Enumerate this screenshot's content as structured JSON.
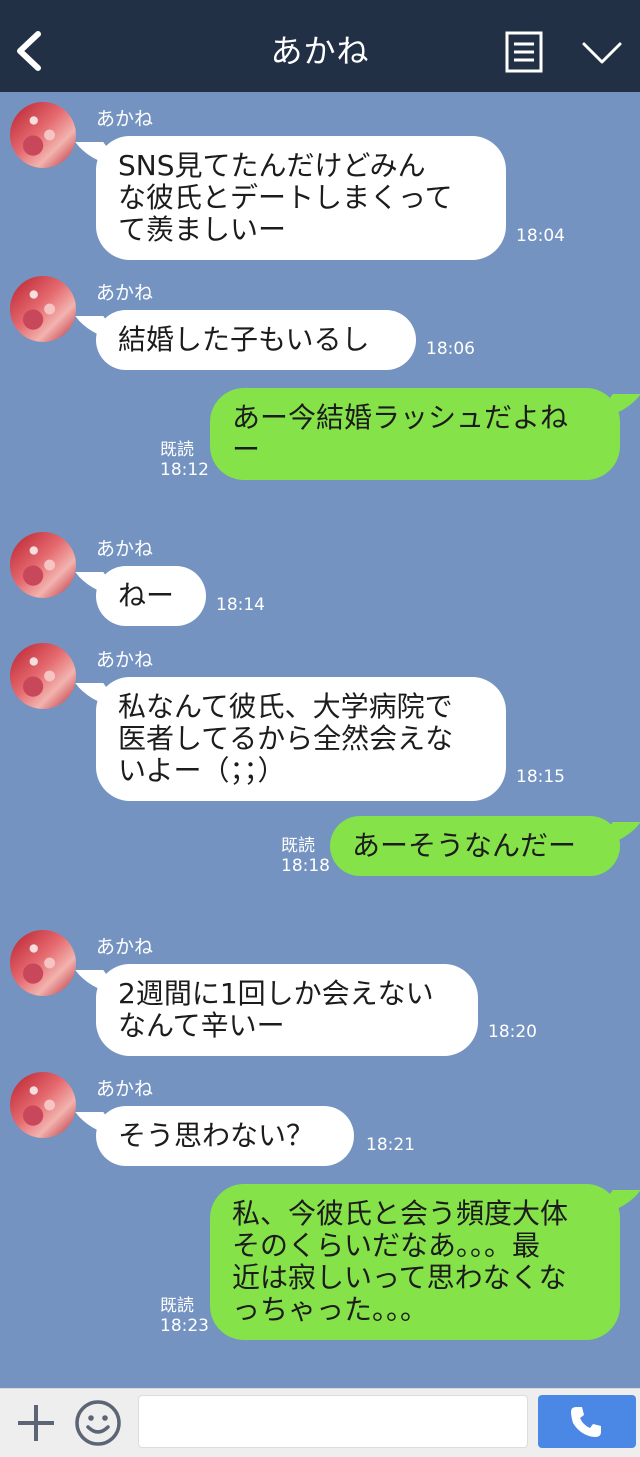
{
  "header": {
    "title": "あかね"
  },
  "colors": {
    "header_bg": "#223046",
    "chat_bg": "#7493c1",
    "incoming_bubble": "#ffffff",
    "outgoing_bubble": "#85e249",
    "send_button": "#4b88e6"
  },
  "messages": [
    {
      "direction": "in",
      "sender": "あかね",
      "text": "SNS見てたんだけどみん\nな彼氏とデートしまくって\nて羨ましいー",
      "time": "18:04"
    },
    {
      "direction": "in",
      "sender": "あかね",
      "text": "結婚した子もいるし",
      "time": "18:06"
    },
    {
      "direction": "out",
      "read": "既読",
      "text": "あー今結婚ラッシュだよね\nー",
      "time": "18:12"
    },
    {
      "direction": "in",
      "sender": "あかね",
      "text": "ねー",
      "time": "18:14"
    },
    {
      "direction": "in",
      "sender": "あかね",
      "text": "私なんて彼氏、大学病院で\n医者してるから全然会えな\nいよー（；；）",
      "time": "18:15"
    },
    {
      "direction": "out",
      "read": "既読",
      "text": "あーそうなんだー",
      "time": "18:18"
    },
    {
      "direction": "in",
      "sender": "あかね",
      "text": "2週間に1回しか会えない\nなんて辛いー",
      "time": "18:20"
    },
    {
      "direction": "in",
      "sender": "あかね",
      "text": "そう思わない？",
      "time": "18:21"
    },
    {
      "direction": "out",
      "read": "既読",
      "text": "私、今彼氏と会う頻度大体\nそのくらいだなあ。。。最\n近は寂しいって思わなくな\nっちゃった。。。",
      "time": "18:23"
    }
  ],
  "input": {
    "value": "",
    "placeholder": ""
  },
  "icons": {
    "back": "chevron-left-icon",
    "menu": "list-icon",
    "collapse": "chevron-down-icon",
    "plus": "plus-icon",
    "emoji": "smiley-icon",
    "call": "phone-icon"
  }
}
